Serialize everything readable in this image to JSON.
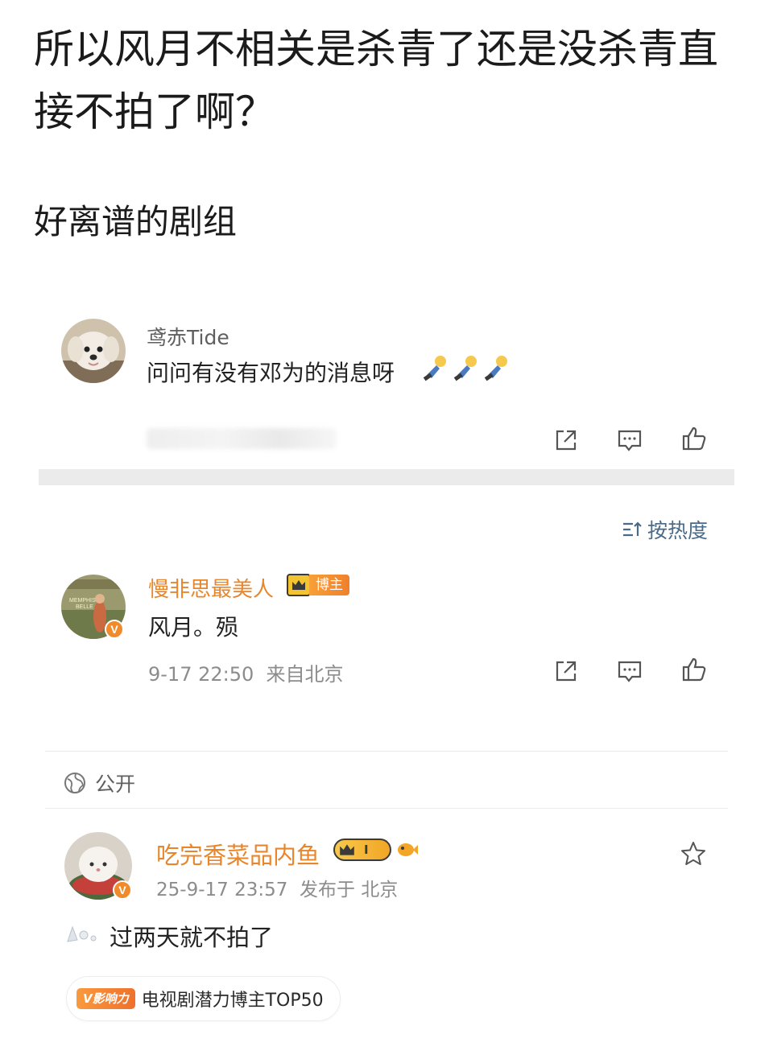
{
  "post": {
    "title": "所以风月不相关是杀青了还是没杀青直接不拍了啊？",
    "subtitle": "好离谱的剧组"
  },
  "quoted_comment": {
    "username": "鸢赤Tide",
    "text": "问问有没有邓为的消息呀",
    "emoji_icon": "bowing-figure-emoji"
  },
  "sort": {
    "label": "按热度",
    "icon": "sort-icon"
  },
  "comment": {
    "username": "慢非思最美人",
    "badge_label": "博主",
    "avatar_text_line1": "MEMPHIS",
    "avatar_text_line2": "BELLE",
    "avatar_badge": "V",
    "text": "风月。殒",
    "time": "9-17 22:50",
    "location": "来自北京"
  },
  "visibility": {
    "label": "公开",
    "icon": "globe-icon"
  },
  "reply": {
    "username": "吃完香菜品内鱼",
    "level_label": "I",
    "avatar_badge": "V",
    "time": "25-9-17 23:57",
    "location": "发布于 北京",
    "text": "过两天就不拍了"
  },
  "influence": {
    "tag": "V影响力",
    "text": "电视剧潜力博主TOP50"
  },
  "colors": {
    "accent_orange": "#e8862c",
    "link_blue": "#4a6a8a",
    "meta_gray": "#8c8c8c",
    "band_gray": "#ebebeb"
  }
}
